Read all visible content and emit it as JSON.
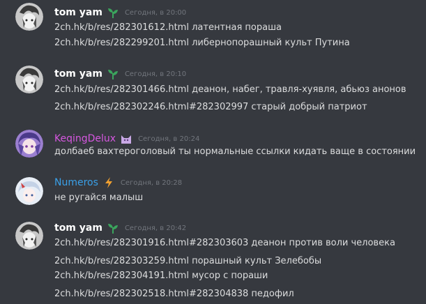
{
  "colors": {
    "background": "#36393f",
    "text": "#dcddde",
    "timestamp": "#72767d",
    "username_default": "#ffffff",
    "username_keqing": "#d657e0",
    "username_numeros": "#3aa0e8",
    "badge_green": "#3ba55d",
    "badge_orange": "#f0a030"
  },
  "messages": [
    {
      "username": "tom yam",
      "badge_icon": "sprout-icon",
      "timestamp": "Сегодня, в 20:00",
      "lines": [
        "2ch.hk/b/res/282301612.html латентная пораша",
        "2ch.hk/b/res/282299201.html либернопорашный культ Путина"
      ]
    },
    {
      "username": "tom yam",
      "badge_icon": "sprout-icon",
      "timestamp": "Сегодня, в 20:10",
      "lines": [
        "2ch.hk/b/res/282301466.html деанон, набег, травля-хуявля, абьюз анонов",
        "2ch.hk/b/res/282302246.html#282302997 старый добрый патриот"
      ]
    },
    {
      "username": "KeqingDelux",
      "badge_icon": "cat-icon",
      "timestamp": "Сегодня, в 20:24",
      "lines": [
        "долбаеб вахтероголовый ты нормальные ссылки кидать ваще в состоянии"
      ]
    },
    {
      "username": "Numeros",
      "badge_icon": "lightning-icon",
      "timestamp": "Сегодня, в 20:28",
      "lines": [
        "не ругайся малыш"
      ]
    },
    {
      "username": "tom yam",
      "badge_icon": "sprout-icon",
      "timestamp": "Сегодня, в 20:42",
      "lines": [
        "2ch.hk/b/res/282301916.html#282303603 деанон против воли человека",
        "2ch.hk/b/res/282303259.html порашный культ Зелебобы",
        "2ch.hk/b/res/282304191.html мусор с пораши",
        "2ch.hk/b/res/282302518.html#282304838 педофил"
      ]
    }
  ]
}
